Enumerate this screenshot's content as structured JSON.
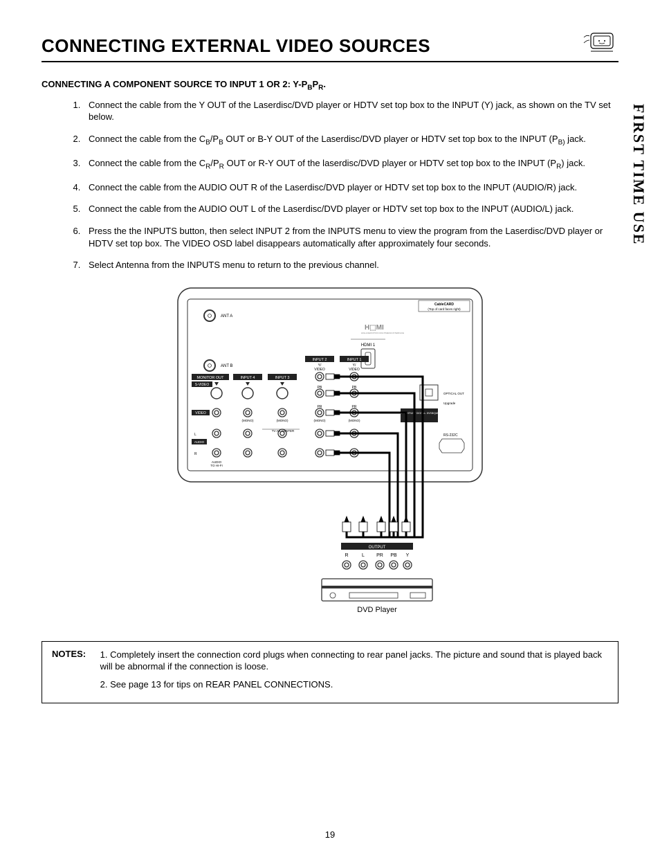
{
  "header": {
    "title": "CONNECTING EXTERNAL VIDEO SOURCES"
  },
  "sidebar": {
    "label": "FIRST TIME USE"
  },
  "subhead": {
    "prefix": "CONNECTING A COMPONENT SOURCE TO INPUT 1 OR 2:  Y-P",
    "sub1": "B",
    "mid": "P",
    "sub2": "R",
    "suffix": "."
  },
  "steps": [
    {
      "text": "Connect the cable from the Y OUT of the Laserdisc/DVD player or HDTV set top box to the INPUT (Y) jack, as shown on the TV set below."
    },
    {
      "html": "Connect the cable from the C<sub>B</sub>/P<sub>B</sub> OUT or B-Y OUT of the Laserdisc/DVD  player or HDTV set top box to the INPUT (P<sub>B)</sub> jack."
    },
    {
      "html": "Connect the cable from the C<sub>R</sub>/P<sub>R</sub> OUT or R-Y OUT of the laserdisc/DVD player or HDTV set top box to the INPUT (P<sub>R</sub>) jack."
    },
    {
      "text": "Connect the cable from the AUDIO OUT R of the Laserdisc/DVD player or   HDTV set top box to the INPUT (AUDIO/R) jack."
    },
    {
      "text": "Connect the cable from the AUDIO OUT L of the Laserdisc/DVD player or HDTV set top box to the INPUT (AUDIO/L) jack."
    },
    {
      "text": "Press the the INPUTS button, then select INPUT 2 from the INPUTS menu to view the program from the Laserdisc/DVD player or HDTV set top box.  The VIDEO OSD label disappears automatically after approximately four seconds."
    },
    {
      "text": "Select Antenna from the INPUTS menu to return to the previous channel."
    }
  ],
  "diagram": {
    "labels": {
      "cablecard": "CableCARD",
      "cablecard_sub": "(Top of card faces right)",
      "hdmi": "HDMI 1",
      "ant_a": "ANT A",
      "ant_b": "ANT B",
      "monitor_out": "MONITOR OUT",
      "input4": "INPUT 4",
      "input3": "INPUT 3",
      "input2": "INPUT 2",
      "input1": "INPUT 1",
      "svideo": "S-VIDEO",
      "video": "VIDEO",
      "audio": "AUDIO",
      "mono": "(MONO)",
      "y_video": "Y/\nVIDEO",
      "pb": "PB",
      "pr": "PR",
      "l": "L",
      "r": "R",
      "audio_hifi": "AUDIO\nTO HI-FI",
      "tv_center": "TV AS CENTER",
      "optical": "OPTICAL OUT",
      "rs232c": "RS-232C",
      "upgrade": "Upgrade",
      "output": "OUTPUT",
      "out_r": "R",
      "out_l": "L",
      "out_pr": "PR",
      "out_pb": "PB",
      "out_y": "Y",
      "dvd": "DVD Player"
    }
  },
  "notes": {
    "label": "NOTES:",
    "items": [
      "Completely insert the connection cord plugs when connecting to rear panel jacks.  The picture and sound that is played back will be abnormal if the connection is loose.",
      "See page 13 for tips on REAR PANEL CONNECTIONS."
    ]
  },
  "page_number": "19"
}
